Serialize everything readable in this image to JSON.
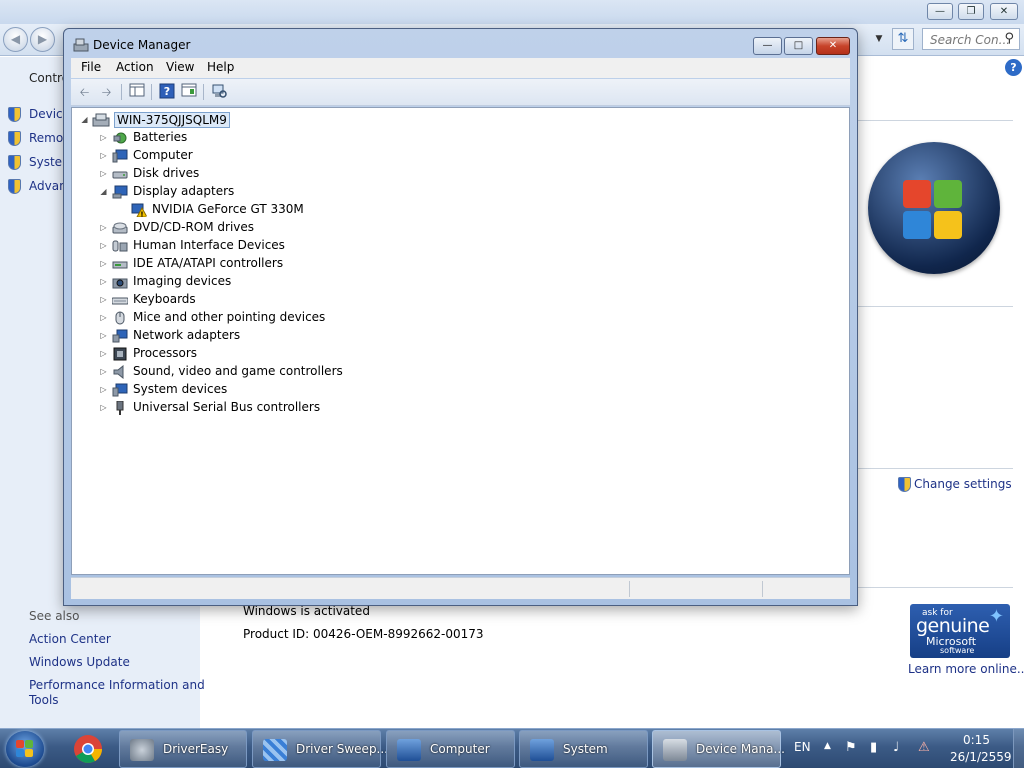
{
  "background_window": {
    "search_placeholder": "Search Con...",
    "sidebar": {
      "header_partial": "Contro",
      "links": [
        "Device",
        "Remot",
        "System",
        "Advan"
      ],
      "see_also_label": "See also",
      "see_also_links": [
        "Action Center",
        "Windows Update",
        "Performance Information and",
        "Tools"
      ]
    },
    "change_settings_label": "Change settings",
    "activation_status": "Windows is activated",
    "product_id": "Product ID: 00426-OEM-8992662-00173",
    "genuine_badge": {
      "line1": "ask for",
      "line2": "genuine",
      "line3": "Microsoft",
      "line4": "software"
    },
    "learn_more_label": "Learn more online..."
  },
  "device_manager": {
    "title": "Device Manager",
    "menu": [
      "File",
      "Action",
      "View",
      "Help"
    ],
    "tree": {
      "root": "WIN-375QJJSQLM9",
      "items": [
        {
          "label": "Batteries",
          "expanded": false,
          "icon": "battery-icon"
        },
        {
          "label": "Computer",
          "expanded": false,
          "icon": "computer-icon"
        },
        {
          "label": "Disk drives",
          "expanded": false,
          "icon": "disk-drive-icon"
        },
        {
          "label": "Display adapters",
          "expanded": true,
          "icon": "display-adapter-icon",
          "children": [
            {
              "label": "NVIDIA GeForce GT 330M",
              "icon": "warning-monitor-icon"
            }
          ]
        },
        {
          "label": "DVD/CD-ROM drives",
          "expanded": false,
          "icon": "dvd-drive-icon"
        },
        {
          "label": "Human Interface Devices",
          "expanded": false,
          "icon": "hid-icon"
        },
        {
          "label": "IDE ATA/ATAPI controllers",
          "expanded": false,
          "icon": "ide-controller-icon"
        },
        {
          "label": "Imaging devices",
          "expanded": false,
          "icon": "imaging-icon"
        },
        {
          "label": "Keyboards",
          "expanded": false,
          "icon": "keyboard-icon"
        },
        {
          "label": "Mice and other pointing devices",
          "expanded": false,
          "icon": "mouse-icon"
        },
        {
          "label": "Network adapters",
          "expanded": false,
          "icon": "network-icon"
        },
        {
          "label": "Processors",
          "expanded": false,
          "icon": "processor-icon"
        },
        {
          "label": "Sound, video and game controllers",
          "expanded": false,
          "icon": "sound-icon"
        },
        {
          "label": "System devices",
          "expanded": false,
          "icon": "system-devices-icon"
        },
        {
          "label": "Universal Serial Bus controllers",
          "expanded": false,
          "icon": "usb-icon"
        }
      ]
    }
  },
  "taskbar": {
    "items": [
      {
        "label": "DriverEasy",
        "active": false
      },
      {
        "label": "Driver Sweep...",
        "active": false
      },
      {
        "label": "Computer",
        "active": false
      },
      {
        "label": "System",
        "active": false
      },
      {
        "label": "Device Mana...",
        "active": true
      }
    ],
    "language": "EN",
    "time": "0:15",
    "date": "26/1/2559"
  },
  "colors": {
    "link_blue": "#1e3287",
    "accent_blue": "#2e6bc7",
    "close_red": "#c7432a",
    "warning_yellow": "#f3c300"
  }
}
